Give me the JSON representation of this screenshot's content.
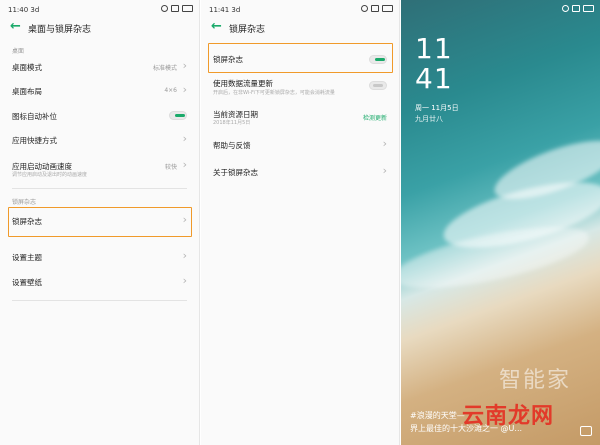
{
  "panel1": {
    "status": {
      "time": "11:40 3d"
    },
    "title": "桌面与锁屏杂志",
    "section_desktop": "桌面",
    "items": [
      {
        "label": "桌面模式",
        "value": "标准模式"
      },
      {
        "label": "桌面布局",
        "value": "4×6"
      },
      {
        "label": "图标自动补位"
      },
      {
        "label": "应用快捷方式"
      },
      {
        "label": "应用启动动画速度",
        "sub": "调节应用启动及退出时的动画速度",
        "value": "较快"
      }
    ],
    "section_lock": "锁屏杂志",
    "lock_item": "锁屏杂志",
    "items2": [
      {
        "label": "设置主题"
      },
      {
        "label": "设置壁纸"
      }
    ]
  },
  "panel2": {
    "status": {
      "time": "11:41 3d"
    },
    "title": "锁屏杂志",
    "items": [
      {
        "label": "锁屏杂志"
      },
      {
        "label": "使用数据流量更新",
        "sub": "开启后，在非Wi-Fi下可更新锁屏杂志，可能会消耗流量"
      },
      {
        "label": "当前资源日期",
        "sub": "2018年11月5日",
        "value": "检测更新"
      },
      {
        "label": "帮助与反馈"
      },
      {
        "label": "关于锁屏杂志"
      }
    ]
  },
  "lockscreen": {
    "hour": "11",
    "minute": "41",
    "date": "周一 11月5日",
    "lunar": "九月廿八",
    "caption_line1": "#浪漫的天堂—",
    "caption_line2": "界上最佳的十大沙滩之一 @U...",
    "watermark": "智能家",
    "site_mark": "云南龙网"
  },
  "colors": {
    "accent": "#1aaa6a",
    "highlight": "#f09a2a"
  }
}
